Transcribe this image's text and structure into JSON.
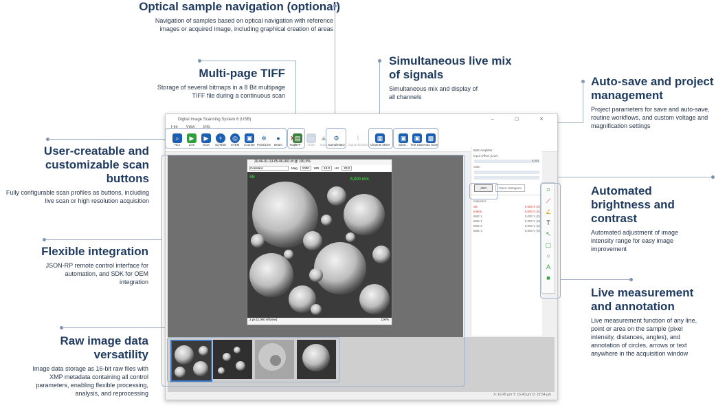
{
  "callouts": {
    "optical": {
      "title": "Optical sample navigation (optional)",
      "desc": "Navigation of samples based on optical navigation with reference images or acquired image, including graphical creation of areas"
    },
    "tiff": {
      "title": "Multi-page TIFF",
      "desc": "Storage of several bitmaps in a 8 Bit multipage TIFF file during a continuous scan"
    },
    "livemix": {
      "title": "Simultaneous live mix of signals",
      "desc": "Simultaneous mix and display of all channels"
    },
    "autosave": {
      "title": "Auto-save and project management",
      "desc": "Project parameters for save and auto-save, routine workflows, and custom voltage and magnification settings"
    },
    "scanbtn": {
      "title": "User-creatable and customizable scan buttons",
      "desc": "Fully configurable scan profiles as buttons, including live scan or high resolution acquisition"
    },
    "integration": {
      "title": "Flexible integration",
      "desc": "JSON-RP remote control interface for automation, and SDK for OEM integration"
    },
    "rawdata": {
      "title": "Raw image data versatility",
      "desc": "Image data storage as 16-bit raw files with XMP metadata containing all control parameters, enabling flexible processing, analysis, and reprocessing"
    },
    "brightness": {
      "title": "Automated brightness and contrast",
      "desc": "Automated adjustment of image intensity range for easy image improvement"
    },
    "measure": {
      "title": "Live measurement and annotation",
      "desc": "Live measurement function of any line, point or area on the sample (pixel intensity, distances, angles), and annotation of circles, arrows or text anywhere in the acquisition window"
    }
  },
  "app": {
    "title": "Digital Image Scanning System 6 (USB)",
    "menu": [
      "File",
      "View",
      "Info"
    ],
    "toolbar": [
      {
        "label": "RCI",
        "icon": "search-icon",
        "color": "#1c5fb0"
      },
      {
        "label": "Live",
        "icon": "play-icon",
        "color": "#2e9e3e"
      },
      {
        "label": "Slow",
        "icon": "play-icon",
        "color": "#1c5fb0"
      },
      {
        "label": "4Q-BSE",
        "icon": "plus-icon",
        "color": "#1c5fb0"
      },
      {
        "label": "STEM",
        "icon": "target-icon",
        "color": "#1c5fb0"
      },
      {
        "label": "Counter",
        "icon": "counter-icon",
        "color": "#1c5fb0"
      },
      {
        "label": "Point/Line",
        "icon": "points-icon",
        "color": "#1c5fb0"
      },
      {
        "label": "Beam",
        "icon": "dot-icon",
        "color": "#1c5fb0"
      },
      {
        "label": "Stop",
        "icon": "x-icon",
        "color": "#d32222"
      }
    ],
    "toolbar2": [
      "TIFF",
      "Video",
      "Stack",
      "SampleNavi",
      "Signal Monitor",
      "Channel Mixer"
    ],
    "toolbar3": [
      "Save...",
      "Test Save",
      "Auto Save"
    ],
    "image_window": {
      "title": "20-06-01-13-05-06-001.tif @ 100,0%",
      "mode": "Constant",
      "mag_label": "Mag",
      "mag": "1000",
      "wd_label": "WD",
      "wd": "10.0",
      "hv_label": "HV",
      "hv": "20,0",
      "scale": "5,000 mm",
      "footer_left": "2 µs (2,000 s/frame)",
      "footer_right": "100%"
    },
    "right_panel": {
      "header": "BSE Amplifier",
      "input_offset": "Input Offset (Live)",
      "gain_label": "Gain",
      "value": "0,001",
      "abc_button": "ABC",
      "open_histogram": "Open Histogram",
      "inspector": "Inspector",
      "rows": [
        "SE",
        "Inlens",
        "BSE 1",
        "BSE 2",
        "BSE 3",
        "BSE 4"
      ],
      "row_values": [
        "0,000 V (0)",
        "0,000 V (0)",
        "0,000 V (0)",
        "0,000 V (0)",
        "0,000 V (0)",
        "0,000 V (0)"
      ]
    },
    "status": "X: 16,45 µm  Y: 15,40 µm  D: 22,54 µm"
  }
}
